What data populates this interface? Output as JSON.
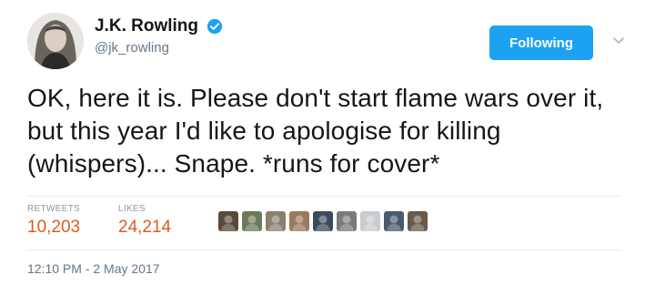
{
  "author": {
    "display_name": "J.K. Rowling",
    "handle": "@jk_rowling",
    "verified": true
  },
  "follow_button": {
    "label": "Following"
  },
  "tweet": {
    "text": "OK, here it is. Please don't start flame wars over it, but this year I'd like to apologise for killing (whispers)... Snape. *runs for cover*"
  },
  "stats": {
    "retweets_label": "RETWEETS",
    "retweets_value": "10,203",
    "likes_label": "LIKES",
    "likes_value": "24,214"
  },
  "likers": [
    {
      "name": "liker-avatar-1",
      "color": "#5a4a3a"
    },
    {
      "name": "liker-avatar-2",
      "color": "#6b7a5a"
    },
    {
      "name": "liker-avatar-3",
      "color": "#8a8070"
    },
    {
      "name": "liker-avatar-4",
      "color": "#9a7a5a"
    },
    {
      "name": "liker-avatar-5",
      "color": "#3c4a5c"
    },
    {
      "name": "liker-avatar-6",
      "color": "#7a7a7a"
    },
    {
      "name": "liker-avatar-7",
      "color": "#c8ccd0"
    },
    {
      "name": "liker-avatar-8",
      "color": "#4a5a6a"
    },
    {
      "name": "liker-avatar-9",
      "color": "#6a5a4a"
    }
  ],
  "timestamp": "12:10 PM - 2 May 2017",
  "colors": {
    "accent": "#1da1f2",
    "stat_value": "#e0591f",
    "muted": "#657786"
  }
}
